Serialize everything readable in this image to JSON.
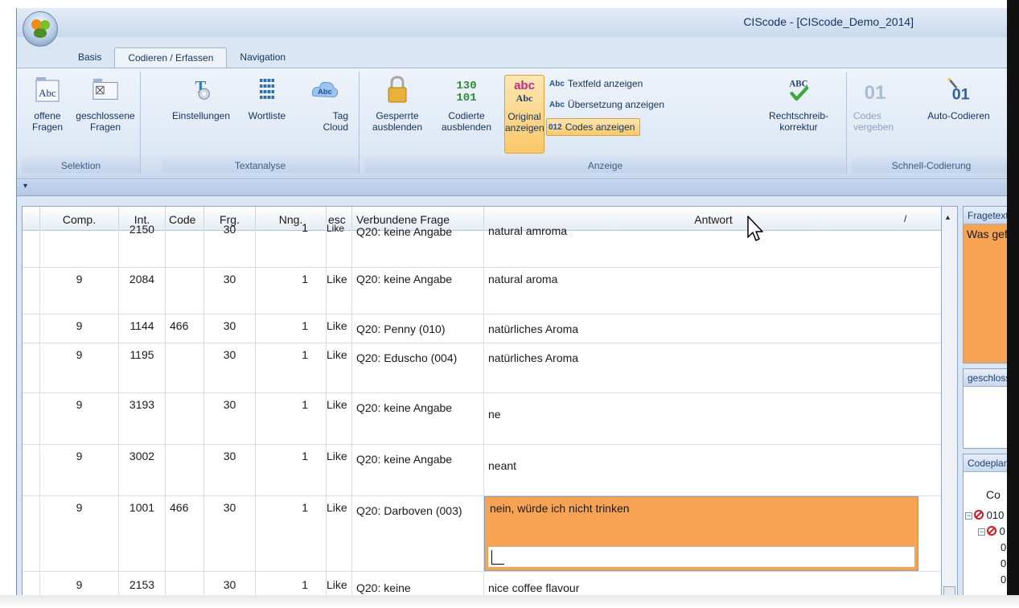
{
  "window": {
    "title": "CIScode - [CIScode_Demo_2014]"
  },
  "tabs": [
    {
      "label": "Basis",
      "active": false
    },
    {
      "label": "Codieren / Erfassen",
      "active": true
    },
    {
      "label": "Navigation",
      "active": false
    }
  ],
  "ribbon": {
    "groups": {
      "selektion": {
        "label": "Selektion",
        "open": "offene\nFragen",
        "closed": "geschlossene\nFragen"
      },
      "textanalyse": {
        "label": "Textanalyse",
        "settings": "Einstellungen",
        "wordlist": "Wortliste",
        "tagcloud": "Tag\nCloud"
      },
      "anzeige": {
        "label": "Anzeige",
        "hide_locked": "Gesperrte\nausblenden",
        "hide_coded": "Codierte\nausblenden",
        "show_original": "Original\nanzeigen",
        "show_textfield": "Textfeld anzeigen",
        "show_translation": "Übersetzung anzeigen",
        "show_codes": "Codes anzeigen",
        "spellcheck": "Rechtschreib-\nkorrektur"
      },
      "schnell": {
        "label": "Schnell-Codierung",
        "assign": "Codes\nvergeben",
        "auto": "Auto-Codieren"
      }
    }
  },
  "qat": {
    "glyph": "▾"
  },
  "grid": {
    "columns": {
      "comp": "Comp.",
      "int": "Int.",
      "code": "Code",
      "frg": "Frg.",
      "nng": "Nng.",
      "desc": "esc",
      "frage": "Verbundene Frage",
      "antwort": "Antwort",
      "sort_indicator": "/"
    },
    "partial_row": {
      "int": "2150",
      "frg": "30",
      "nng": "1",
      "desc": "Like",
      "frage": "Q20: keine Angabe",
      "antwort": "natural amroma"
    },
    "rows": [
      {
        "comp": "9",
        "int": "2084",
        "code": "",
        "frg": "30",
        "nng": "1",
        "desc": "Like",
        "frage": "Q20: keine Angabe",
        "antwort": "natural aroma"
      },
      {
        "comp": "9",
        "int": "1144",
        "code": "466",
        "frg": "30",
        "nng": "1",
        "desc": "Like",
        "frage": "Q20: Penny (010)",
        "antwort": "natürliches Aroma"
      },
      {
        "comp": "9",
        "int": "1195",
        "code": "",
        "frg": "30",
        "nng": "1",
        "desc": "Like",
        "frage": "Q20: Eduscho (004)",
        "antwort": "natürliches Aroma"
      },
      {
        "comp": "9",
        "int": "3193",
        "code": "",
        "frg": "30",
        "nng": "1",
        "desc": "Like",
        "frage": "Q20: keine Angabe",
        "antwort": "ne"
      },
      {
        "comp": "9",
        "int": "3002",
        "code": "",
        "frg": "30",
        "nng": "1",
        "desc": "Like",
        "frage": "Q20: keine Angabe",
        "antwort": "neant"
      },
      {
        "comp": "9",
        "int": "1001",
        "code": "466",
        "frg": "30",
        "nng": "1",
        "desc": "Like",
        "frage": "Q20: Darboven (003)",
        "antwort": "nein, würde ich nicht trinken"
      },
      {
        "comp": "9",
        "int": "2153",
        "code": "",
        "frg": "30",
        "nng": "1",
        "desc": "Like",
        "frage": "Q20: keine",
        "antwort": "nice coffee flavour"
      }
    ]
  },
  "panes": {
    "fragetext": {
      "title": "Fragetext",
      "body": "Was gefä"
    },
    "geschlossen": {
      "title": "geschloss"
    },
    "codeplan": {
      "title": "Codeplan",
      "col": "Co",
      "items": [
        "010",
        "0",
        "0",
        "0",
        "0"
      ]
    }
  },
  "colors": {
    "accent": "#f7a354",
    "ribbon": "#dbe6f4",
    "highlight": "#f9c86a"
  }
}
